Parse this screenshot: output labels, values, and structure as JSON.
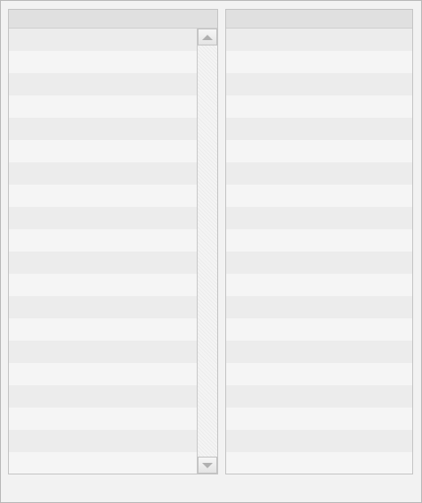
{
  "left_list": {
    "header": "",
    "rows": [
      "",
      "",
      "",
      "",
      "",
      "",
      "",
      "",
      "",
      "",
      "",
      "",
      "",
      "",
      "",
      "",
      "",
      "",
      "",
      ""
    ]
  },
  "right_list": {
    "header": "",
    "rows": [
      "",
      "",
      "",
      "",
      "",
      "",
      "",
      "",
      "",
      "",
      "",
      "",
      "",
      "",
      "",
      "",
      "",
      "",
      "",
      ""
    ]
  },
  "icons": {
    "scroll_up": "scroll-up-arrow-icon",
    "scroll_down": "scroll-down-arrow-icon"
  },
  "colors": {
    "background": "#f2f2f2",
    "header": "#e0e0e0",
    "row_odd": "#ececec",
    "row_even": "#f5f5f5",
    "border": "#c4c4c4"
  }
}
